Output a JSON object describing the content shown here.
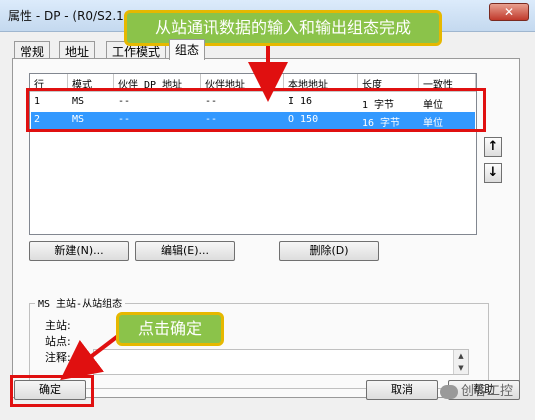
{
  "window": {
    "title": "属性 - DP - (R0/S2.1",
    "close_icon": "close-icon"
  },
  "tabs": [
    {
      "label": "常规"
    },
    {
      "label": "地址"
    },
    {
      "label": "工作模式"
    },
    {
      "label": "组态"
    }
  ],
  "table": {
    "columns": [
      "行",
      "模式",
      "伙伴 DP 地址",
      "伙伴地址",
      "本地地址",
      "长度",
      "一致性"
    ],
    "rows": [
      {
        "row": "1",
        "mode": "MS",
        "partner_dp": "--",
        "partner_addr": "--",
        "local": "I 16",
        "length": "1 字节",
        "consistency": "单位"
      },
      {
        "row": "2",
        "mode": "MS",
        "partner_dp": "--",
        "partner_addr": "--",
        "local": "O 150",
        "length": "16 字节",
        "consistency": "单位"
      }
    ]
  },
  "side_buttons": {
    "up": "↑",
    "down": "↓"
  },
  "buttons": {
    "new": "新建(N)...",
    "edit": "编辑(E)...",
    "delete": "删除(D)"
  },
  "group": {
    "title": "MS 主站-从站组态",
    "master_label": "主站:",
    "station_label": "站点:",
    "comment_label": "注释:"
  },
  "footer": {
    "ok": "确定",
    "cancel": "取消",
    "help": "帮助"
  },
  "callouts": {
    "top": "从站通讯数据的输入和输出组态完成",
    "bottom": "点击确定"
  },
  "watermark": "创客工控",
  "colors": {
    "callout_bg": "#8bc34a",
    "callout_border": "#e6b800",
    "highlight_red": "#e01010",
    "selection": "#3399ff"
  }
}
